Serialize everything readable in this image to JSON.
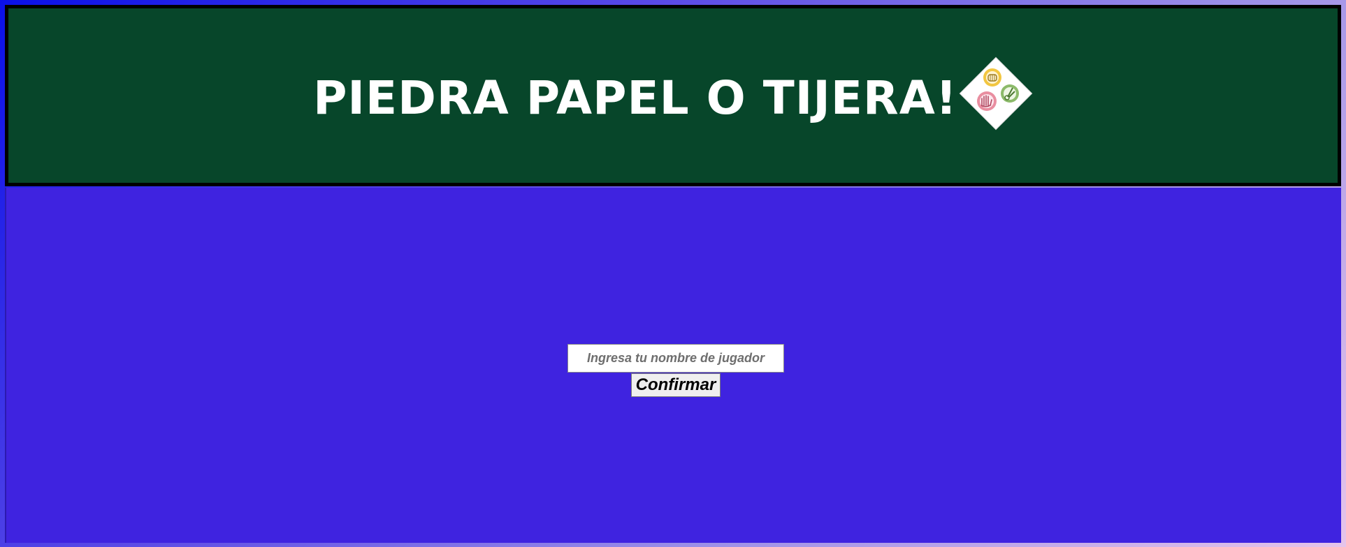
{
  "header": {
    "title": "PIEDRA PAPEL O TIJERA!",
    "logo_icon": "rock-paper-scissors-logo-icon"
  },
  "form": {
    "name_input": {
      "value": "",
      "placeholder": "Ingresa tu nombre de jugador"
    },
    "confirm_label": "Confirmar"
  },
  "colors": {
    "header_bg": "#07462a",
    "main_bg": "#3f23e0",
    "title_text": "#ffffff"
  }
}
